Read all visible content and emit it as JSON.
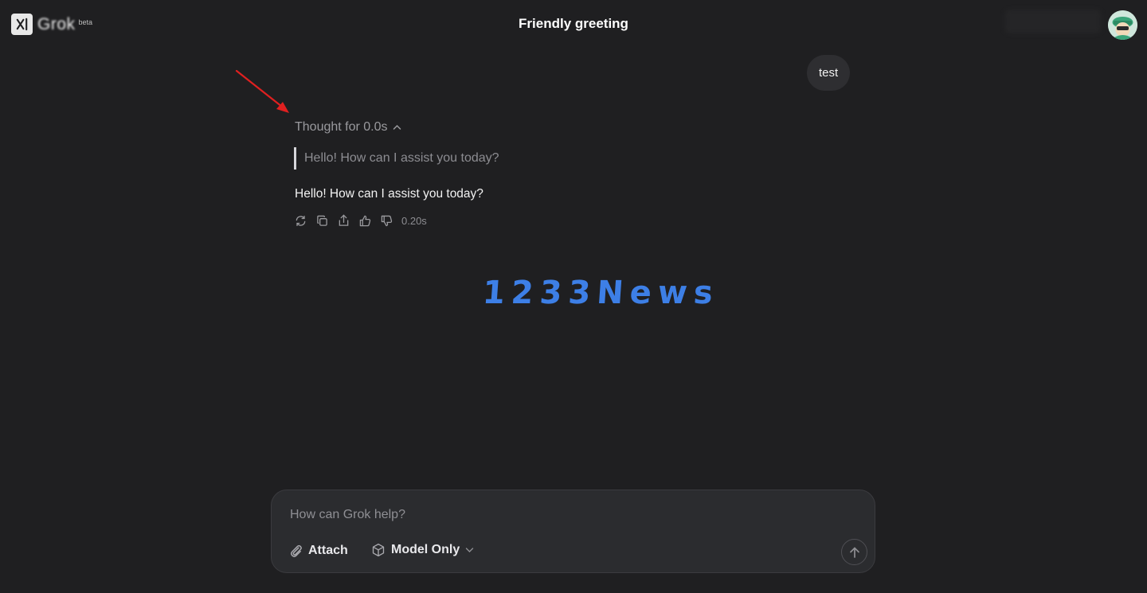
{
  "app": {
    "logo_text": "Grok",
    "beta_label": "beta"
  },
  "header": {
    "title": "Friendly greeting"
  },
  "conversation": {
    "user_message": "test",
    "thought_toggle_label": "Thought for 0.0s",
    "thought_text": "Hello! How can I assist you today?",
    "answer_text": "Hello! How can I assist you today?",
    "response_time": "0.20s",
    "action_icons": [
      "regenerate-icon",
      "copy-icon",
      "share-icon",
      "thumbs-up-icon",
      "thumbs-down-icon"
    ]
  },
  "watermark": {
    "text": "1233News",
    "color": "#3d7fe6"
  },
  "composer": {
    "placeholder": "How can Grok help?",
    "attach_label": "Attach",
    "model_label": "Model Only"
  },
  "colors": {
    "background": "#1f1f21",
    "composer": "#2b2c2f",
    "annotation_arrow": "#e02020"
  }
}
